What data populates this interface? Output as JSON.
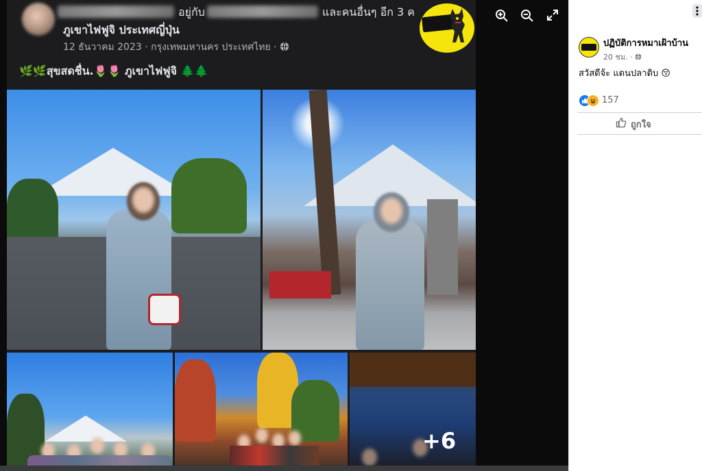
{
  "post": {
    "with_text": "อยู่กับ",
    "and_others": "และคนอื่นๆ อีก 3 ค",
    "location_title": "ภูเขาไฟฟูจิ ประเทศญี่ปุ่น",
    "meta": "12 ธันวาคม 2023 · กรุงเทพมหานคร ประเทศไทย · ",
    "privacy_icon": "globe-icon",
    "caption": "🌿🌿สุขสดชื่น.🌷🌷 ภูเขาไฟฟูจิ 🌲🌲",
    "more_photos": "+6"
  },
  "viewer": {
    "controls": [
      "zoom-in-icon",
      "zoom-out-icon",
      "fullscreen-icon"
    ]
  },
  "side_panel": {
    "page_name": "ปฏิบัติการหมาเฝ้าบ้าน",
    "post_time": "20 ชม. · ",
    "post_text": "สวัสดีจ้ะ แดนปลาดิบ 😚",
    "reaction_count": "157",
    "like_label": "ถูกใจ"
  },
  "colors": {
    "panel_bg": "#ffffff",
    "viewer_bg": "#0b0b0b",
    "like_blue": "#1877f2",
    "haha_yellow": "#f7b125",
    "logo_yellow": "#f5e50c"
  }
}
